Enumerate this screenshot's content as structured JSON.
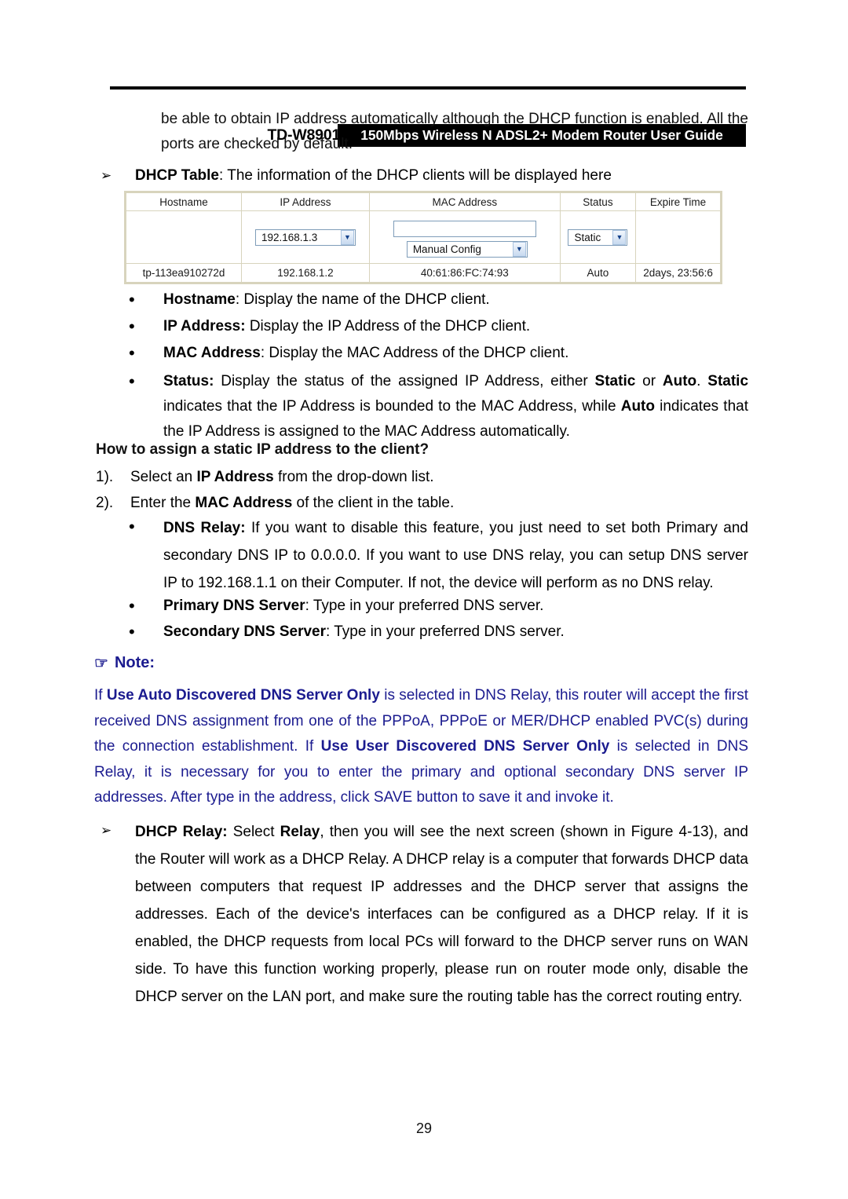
{
  "header": {
    "model": "TD-W8901N",
    "banner_title": "150Mbps Wireless N ADSL2+ Modem Router User Guide"
  },
  "intro": {
    "paragraph": "be able to obtain IP address automatically although the DHCP function is enabled. All the ports are checked by default."
  },
  "bullets": {
    "dhcp_table": {
      "marker": "➢",
      "label": "DHCP Table",
      "text": ": The information of the DHCP clients will be displayed here"
    },
    "hostname": {
      "marker": "•",
      "label": "Hostname",
      "text": ": Display the name of the DHCP client."
    },
    "ip_address": {
      "marker": "•",
      "label": "IP Address:",
      "text": " Display the IP Address of the DHCP client."
    },
    "mac_address": {
      "marker": "•",
      "label": "MAC Address",
      "text": ": Display the MAC Address of the DHCP client."
    },
    "status": {
      "marker": "•",
      "label": "Status:",
      "t1": " Display the status of the assigned IP Address, either ",
      "b1": "Static",
      "t2": " or ",
      "b2": "Auto",
      "t3": ". ",
      "b3": "Static",
      "t4": " indicates that the IP Address is bounded to the MAC Address, while ",
      "b4": "Auto",
      "t5": " indicates that the IP Address is assigned to the MAC Address automatically."
    },
    "dns_relay": {
      "marker": "•",
      "label": "DNS Relay:",
      "text": " If you want to disable this feature, you just need to set both Primary and secondary DNS IP to 0.0.0.0. If you want to use DNS relay, you can setup DNS server IP to 192.168.1.1 on their Computer. If not, the device will perform as no DNS relay."
    },
    "primary_dns": {
      "marker": "•",
      "label": "Primary DNS Server",
      "text": ": Type in your preferred DNS server."
    },
    "secondary_dns": {
      "marker": "•",
      "label": "Secondary DNS Server",
      "text": ": Type in your preferred DNS server."
    },
    "dhcp_relay": {
      "marker": "➢",
      "label": "DHCP Relay:",
      "t1": " Select ",
      "b1": "Relay",
      "t2": ", then you will see the next screen (shown in Figure 4-13), and the Router will work as a DHCP Relay. A DHCP relay is a computer that forwards DHCP data between computers that request IP addresses and the DHCP server that assigns the addresses. Each of the device's interfaces can be configured as a DHCP relay. If it is enabled, the DHCP requests from local PCs will forward to the DHCP server runs on WAN side. To have this function working properly, please run on router mode only, disable the DHCP server on the LAN port, and make sure the routing table has the correct routing entry."
    }
  },
  "howto": {
    "heading": "How to assign a static IP address to the client?",
    "steps": [
      {
        "number": "1).",
        "t1": "Select an ",
        "b1": "IP Address",
        "t2": " from the drop-down list."
      },
      {
        "number": "2).",
        "t1": "Enter the ",
        "b1": "MAC Address",
        "t2": " of the client in the table."
      }
    ]
  },
  "note": {
    "icon": "☞",
    "title": "Note:",
    "t1": "If ",
    "b1": "Use Auto Discovered DNS Server Only",
    "t2": " is selected in DNS Relay, this router will accept the first received DNS assignment from one of the PPPoA, PPPoE or MER/DHCP enabled PVC(s) during the connection establishment. If ",
    "b2": "Use User Discovered DNS Server Only",
    "t3": " is selected in DNS Relay, it is necessary for you to enter the primary and optional secondary DNS server IP addresses. After type in the address, click SAVE button to save it and invoke it.",
    "color": "#1b1b8f"
  },
  "dhcp_table": {
    "columns": [
      "Hostname",
      "IP Address",
      "MAC Address",
      "Status",
      "Expire Time"
    ],
    "edit_row": {
      "hostname": "",
      "ip_select_value": "192.168.1.3",
      "mac_textbox_value": "",
      "mac_select_value": "Manual Config",
      "status_select_value": "Static",
      "expire_time": ""
    },
    "data_rows": [
      {
        "hostname": "tp-113ea910272d",
        "ip_address": "192.168.1.2",
        "mac_address": "40:61:86:FC:74:93",
        "status": "Auto",
        "expire_time": "2days, 23:56:6"
      }
    ],
    "dropdown_arrow_glyph": "▼"
  },
  "footer": {
    "page_number": "29"
  }
}
